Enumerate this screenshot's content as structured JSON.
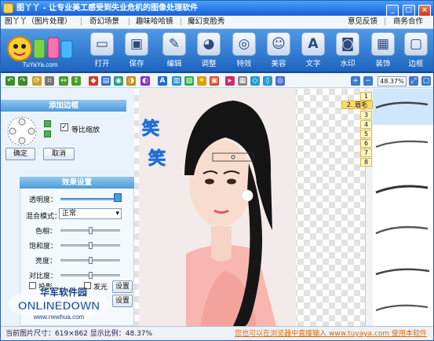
{
  "window": {
    "title": "图丫丫 - 让专业美工感受到失业危机的图像处理软件",
    "controls": [
      "_",
      "□",
      "×"
    ]
  },
  "menu": {
    "left": [
      "图丫丫（图片处理）",
      "奇幻场景",
      "趣味哈哈镜",
      "魔幻变脸秀"
    ],
    "right": [
      "意见反馈",
      "商务合作"
    ]
  },
  "logo": {
    "text": "TuYaYa.com"
  },
  "toolbar": {
    "buttons": [
      {
        "label": "打开",
        "icon": "folder-icon"
      },
      {
        "label": "保存",
        "icon": "floppy-icon"
      },
      {
        "label": "编辑",
        "icon": "edit-icon"
      },
      {
        "label": "调整",
        "icon": "palette-icon"
      },
      {
        "label": "特效",
        "icon": "effects-icon"
      },
      {
        "label": "美容",
        "icon": "face-icon"
      },
      {
        "label": "文字",
        "icon": "text-icon"
      },
      {
        "label": "水印",
        "icon": "watermark-icon"
      },
      {
        "label": "装饰",
        "icon": "decoration-icon"
      },
      {
        "label": "边框",
        "icon": "frame-icon"
      }
    ]
  },
  "toolbar2": {
    "zoom": "48.37%"
  },
  "border_panel": {
    "title": "添加边框",
    "lock_ratio_label": "等比缩放",
    "lock_ratio_checked": true,
    "ok_label": "确定",
    "cancel_label": "取消"
  },
  "effects_panel": {
    "title": "效果设置",
    "opacity_label": "透明度：",
    "blend_label": "混合模式：",
    "blend_value": "正常",
    "hue_label": "色相：",
    "saturation_label": "饱和度：",
    "brightness_label": "亮度：",
    "contrast_label": "对比度：",
    "shadow_label": "投影",
    "glow_label": "发光",
    "settings_label_1": "设置",
    "settings_label_2": "设置"
  },
  "canvas": {
    "decor_text": "笑笑"
  },
  "right_panel": {
    "tabs": [
      "1",
      "2. 眉毛",
      "3",
      "4",
      "5",
      "6",
      "7",
      "8"
    ],
    "selected_tab": "2. 眉毛"
  },
  "status": {
    "left": "当前图片尺寸：619×862   显示比例：48.37%",
    "right": "您也可以在浏览器中直接输入 www.tuyaya.com 使用本软件"
  },
  "watermark": {
    "line1": "华军软件园",
    "line2": "ONLINEDOWN",
    "line3": "www.newhua.com"
  },
  "colors": {
    "accent": "#1e64bf",
    "panel_header": "#4e9ad8",
    "status_link": "#e06a00"
  }
}
